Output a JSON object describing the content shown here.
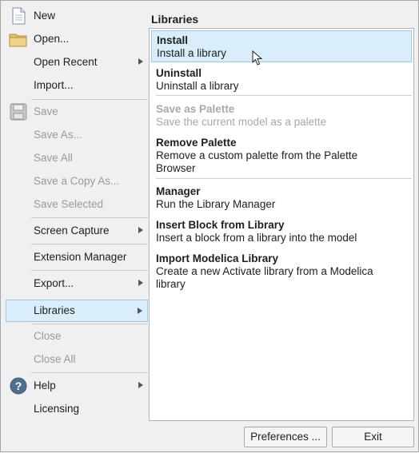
{
  "menu": {
    "new": "New",
    "open": "Open...",
    "open_recent": "Open Recent",
    "import": "Import...",
    "save": "Save",
    "save_as": "Save As...",
    "save_all": "Save All",
    "save_copy_as": "Save a Copy As...",
    "save_selected": "Save Selected",
    "screen_capture": "Screen Capture",
    "extension_manager": "Extension Manager",
    "export": "Export...",
    "libraries": "Libraries",
    "close": "Close",
    "close_all": "Close All",
    "help": "Help",
    "licensing": "Licensing"
  },
  "panel": {
    "title": "Libraries",
    "items": [
      {
        "title": "Install",
        "desc": "Install a library"
      },
      {
        "title": "Uninstall",
        "desc": "Uninstall a library"
      },
      {
        "title": "Save as Palette",
        "desc": "Save the current model as a palette"
      },
      {
        "title": "Remove Palette",
        "desc": "Remove a custom palette from the Palette Browser"
      },
      {
        "title": "Manager",
        "desc": "Run the Library Manager"
      },
      {
        "title": "Insert Block from Library",
        "desc": "Insert a block from a library into the model"
      },
      {
        "title": "Import Modelica Library",
        "desc": "Create a new Activate library from a Modelica library"
      }
    ]
  },
  "buttons": {
    "preferences": "Preferences ...",
    "exit": "Exit"
  },
  "icons": [
    "new-document-icon",
    "open-folder-icon",
    "save-disk-icon",
    "help-icon",
    "submenu-arrow-icon",
    "mouse-cursor-icon"
  ]
}
